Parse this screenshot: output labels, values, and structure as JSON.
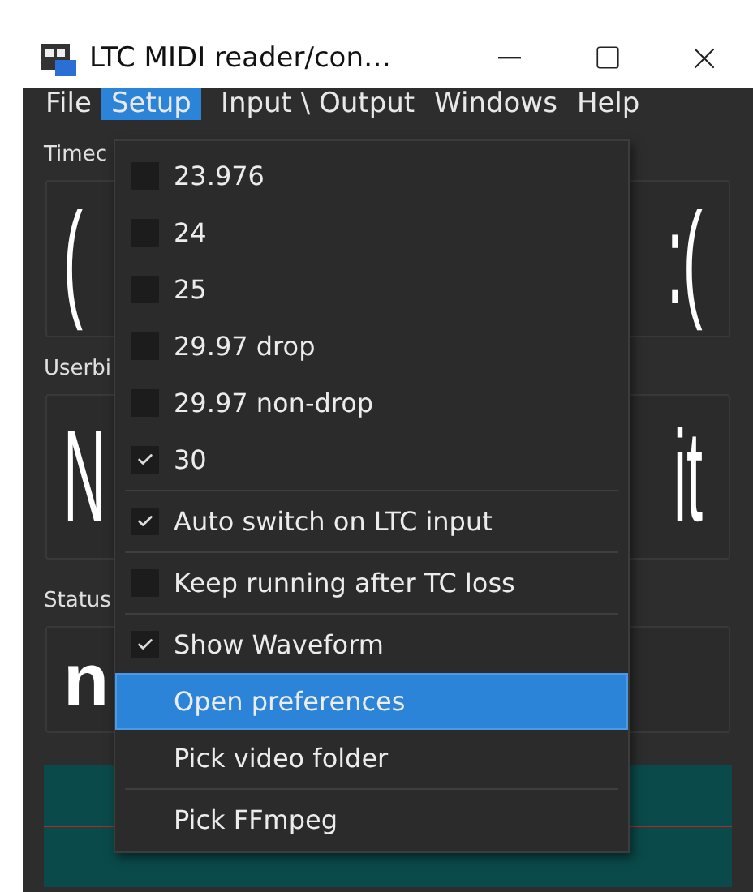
{
  "window": {
    "title": "LTC MIDI reader/con…"
  },
  "menu_bar": [
    {
      "label": "File",
      "selected": false
    },
    {
      "label": "Setup",
      "selected": true
    },
    {
      "label": "Input \\ Output",
      "selected": false
    },
    {
      "label": "Windows",
      "selected": false
    },
    {
      "label": "Help",
      "selected": false
    }
  ],
  "setup_menu": [
    {
      "kind": "check",
      "label": "23.976",
      "checked": false,
      "highlighted": false
    },
    {
      "kind": "check",
      "label": "24",
      "checked": false,
      "highlighted": false
    },
    {
      "kind": "check",
      "label": "25",
      "checked": false,
      "highlighted": false
    },
    {
      "kind": "check",
      "label": "29.97 drop",
      "checked": false,
      "highlighted": false
    },
    {
      "kind": "check",
      "label": "29.97 non-drop",
      "checked": false,
      "highlighted": false
    },
    {
      "kind": "check",
      "label": "30",
      "checked": true,
      "highlighted": false
    },
    {
      "kind": "separator"
    },
    {
      "kind": "check",
      "label": "Auto switch on LTC input",
      "checked": true,
      "highlighted": false
    },
    {
      "kind": "separator"
    },
    {
      "kind": "check",
      "label": "Keep running after TC loss",
      "checked": false,
      "highlighted": false
    },
    {
      "kind": "separator"
    },
    {
      "kind": "check",
      "label": "Show Waveform",
      "checked": true,
      "highlighted": false
    },
    {
      "kind": "action",
      "label": "Open preferences",
      "highlighted": true
    },
    {
      "kind": "action",
      "label": "Pick video folder",
      "highlighted": false
    },
    {
      "kind": "separator"
    },
    {
      "kind": "action",
      "label": "Pick FFmpeg",
      "highlighted": false
    }
  ],
  "sections": [
    {
      "kind": "big",
      "label": "Timec",
      "left": "(",
      "right": ":("
    },
    {
      "kind": "big",
      "label": "Userbi",
      "left": "N",
      "right": "it"
    },
    {
      "kind": "status",
      "label": "Status",
      "left": "n"
    }
  ]
}
